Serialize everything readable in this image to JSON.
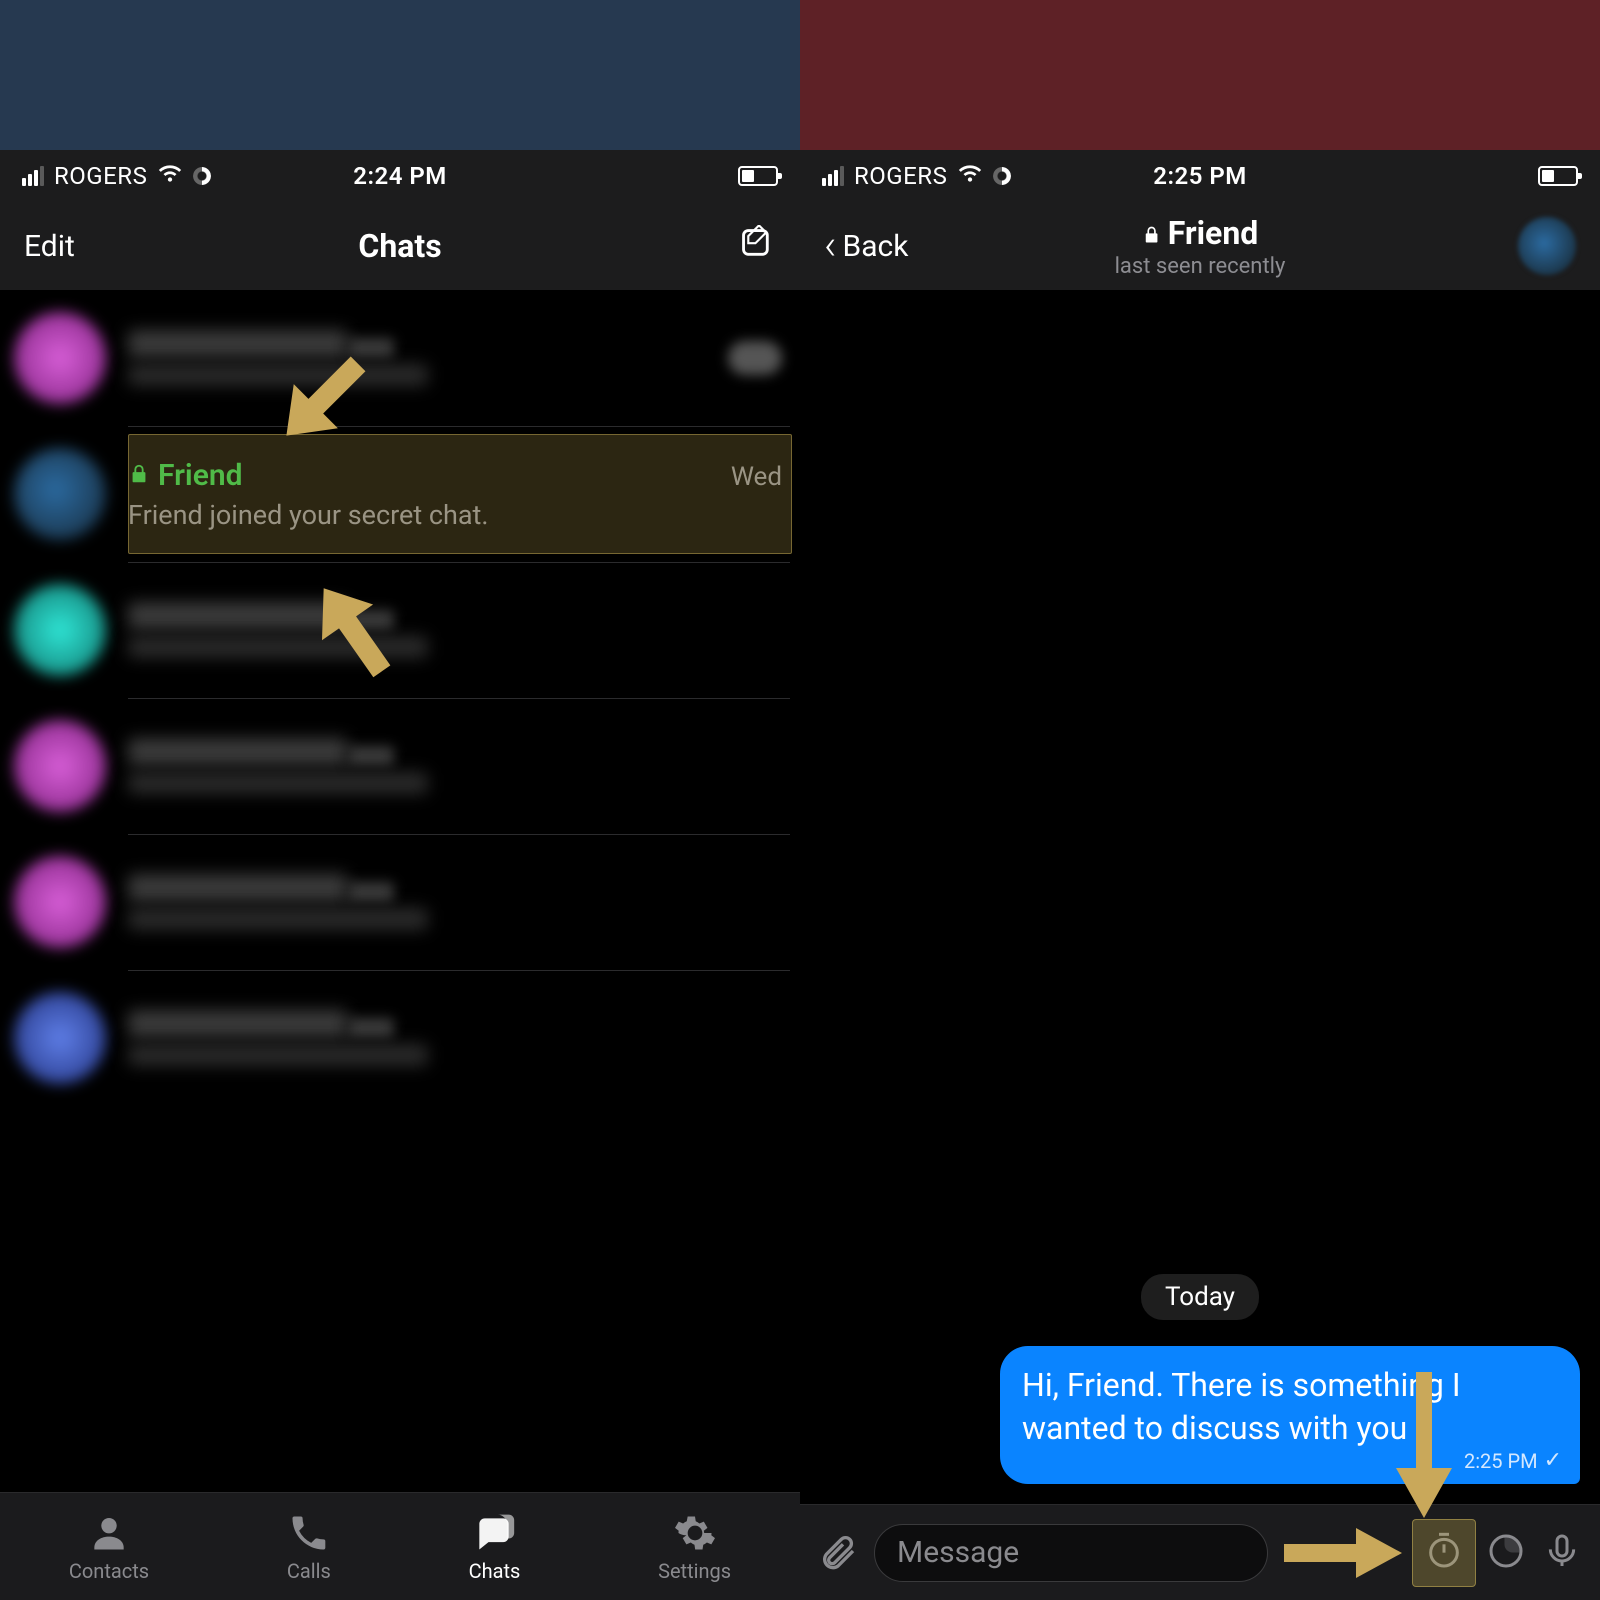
{
  "left": {
    "status": {
      "carrier": "ROGERS",
      "time": "2:24 PM"
    },
    "nav": {
      "edit_label": "Edit",
      "title": "Chats"
    },
    "secret_row": {
      "name": "Friend",
      "preview": "Friend joined your secret chat.",
      "date": "Wed"
    },
    "tabs": {
      "contacts": "Contacts",
      "calls": "Calls",
      "chats": "Chats",
      "settings": "Settings"
    }
  },
  "right": {
    "status": {
      "carrier": "ROGERS",
      "time": "2:25 PM"
    },
    "nav": {
      "back_label": "Back",
      "title": "Friend",
      "subtitle": "last seen recently"
    },
    "date_separator": "Today",
    "message": {
      "text": "Hi, Friend. There is something I wanted to discuss with you",
      "time": "2:25 PM"
    },
    "input_placeholder": "Message"
  }
}
